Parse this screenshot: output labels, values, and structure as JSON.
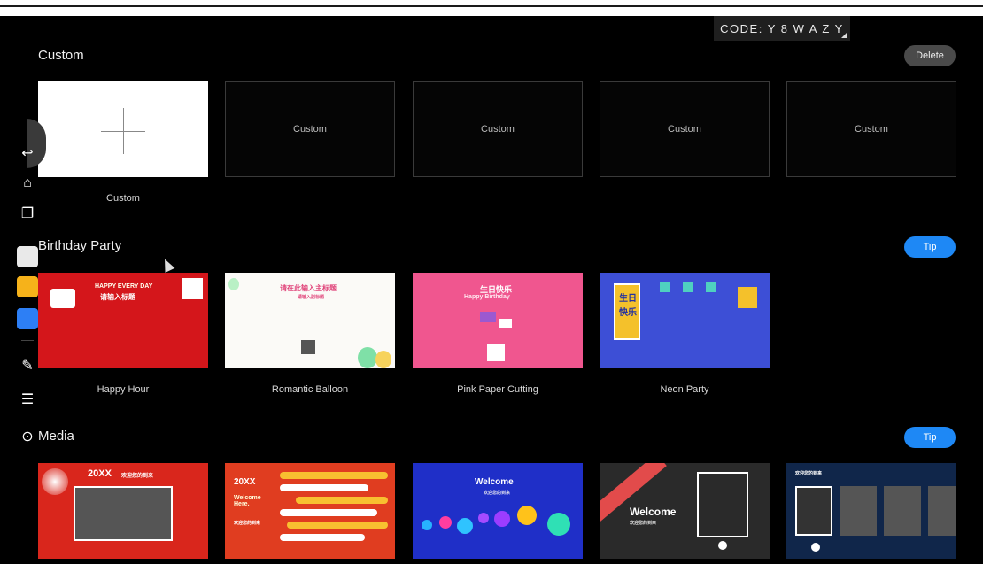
{
  "code_label": "CODE: Y 8 W A Z Y",
  "sections": {
    "custom": {
      "title": "Custom",
      "action": "Delete",
      "add_caption": "Custom",
      "slots": [
        "Custom",
        "Custom",
        "Custom",
        "Custom"
      ]
    },
    "birthday": {
      "title": "Birthday Party",
      "action": "Tip",
      "templates": [
        {
          "name": "Happy Hour",
          "text1": "HAPPY EVERY DAY",
          "text2": "请输入标题"
        },
        {
          "name": "Romantic Balloon",
          "text1": "请在此输入主标题",
          "text2": "请输入副标题"
        },
        {
          "name": "Pink Paper Cutting",
          "text1": "生日快乐",
          "text2": "Happy Birthday"
        },
        {
          "name": "Neon Party",
          "text1": "生日",
          "text2": "快乐"
        }
      ]
    },
    "media": {
      "title": "Media",
      "action": "Tip",
      "templates": [
        {
          "t1": "20XX",
          "t2": "欢迎您的到来"
        },
        {
          "t1": "20XX",
          "t2": "Welcome Here.",
          "t3": "欢迎您的到来"
        },
        {
          "t1": "Welcome",
          "t2": "欢迎您的到来"
        },
        {
          "t1": "Welcome",
          "t2": "欢迎您的到来"
        },
        {
          "t1": "欢迎您的到来"
        }
      ]
    }
  },
  "toolbar": [
    "back-icon",
    "home-icon",
    "windows-icon",
    "whiteboard-icon",
    "notes-icon",
    "apps-icon",
    "pen-icon",
    "settings-icon",
    "more-icon"
  ],
  "colors": {
    "accent_blue": "#1e88f5",
    "delete_grey": "#4a4a4a",
    "bg": "#000000"
  }
}
